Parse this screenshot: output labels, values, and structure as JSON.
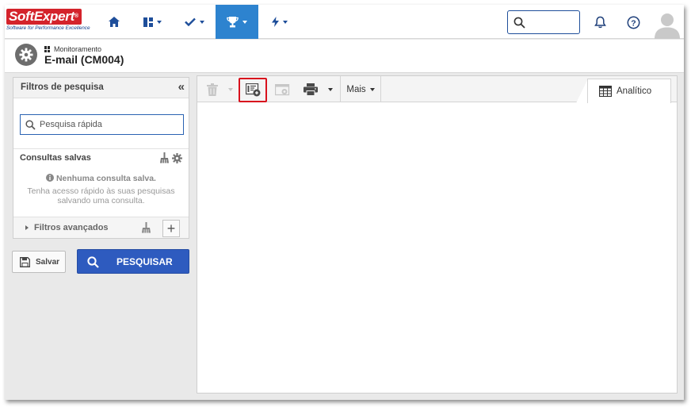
{
  "brand": {
    "name": "SoftExpert",
    "name_a": "Soft",
    "name_b": "Expert",
    "tagline": "Software for Performance Excellence",
    "color": "#d4232b"
  },
  "nav": {
    "items": [
      {
        "icon": "home-icon"
      },
      {
        "icon": "dashboard-icon"
      },
      {
        "icon": "check-icon"
      },
      {
        "icon": "trophy-icon",
        "active": true
      },
      {
        "icon": "bolt-icon"
      }
    ],
    "active_color": "#2d83cf",
    "search_icon": "search-icon",
    "bell_icon": "bell-icon",
    "help_icon": "help-icon",
    "avatar_icon": "user-avatar-icon"
  },
  "header": {
    "breadcrumb": "Monitoramento",
    "title": "E-mail (CM004)"
  },
  "filters": {
    "title": "Filtros de pesquisa",
    "collapse": "«",
    "quick_search_placeholder": "Pesquisa rápida",
    "saved_title": "Consultas salvas",
    "none_message": "Nenhuma consulta salva.",
    "hint": "Tenha acesso rápido às suas pesquisas salvando uma consulta.",
    "advanced_title": "Filtros avançados",
    "add": "+"
  },
  "actions": {
    "save_label": "Salvar",
    "search_label": "PESQUISAR",
    "search_color": "#2e5bbf"
  },
  "toolbar": {
    "mais_label": "Mais",
    "tab_label": "Analítico",
    "highlight_color": "#d8111d"
  }
}
